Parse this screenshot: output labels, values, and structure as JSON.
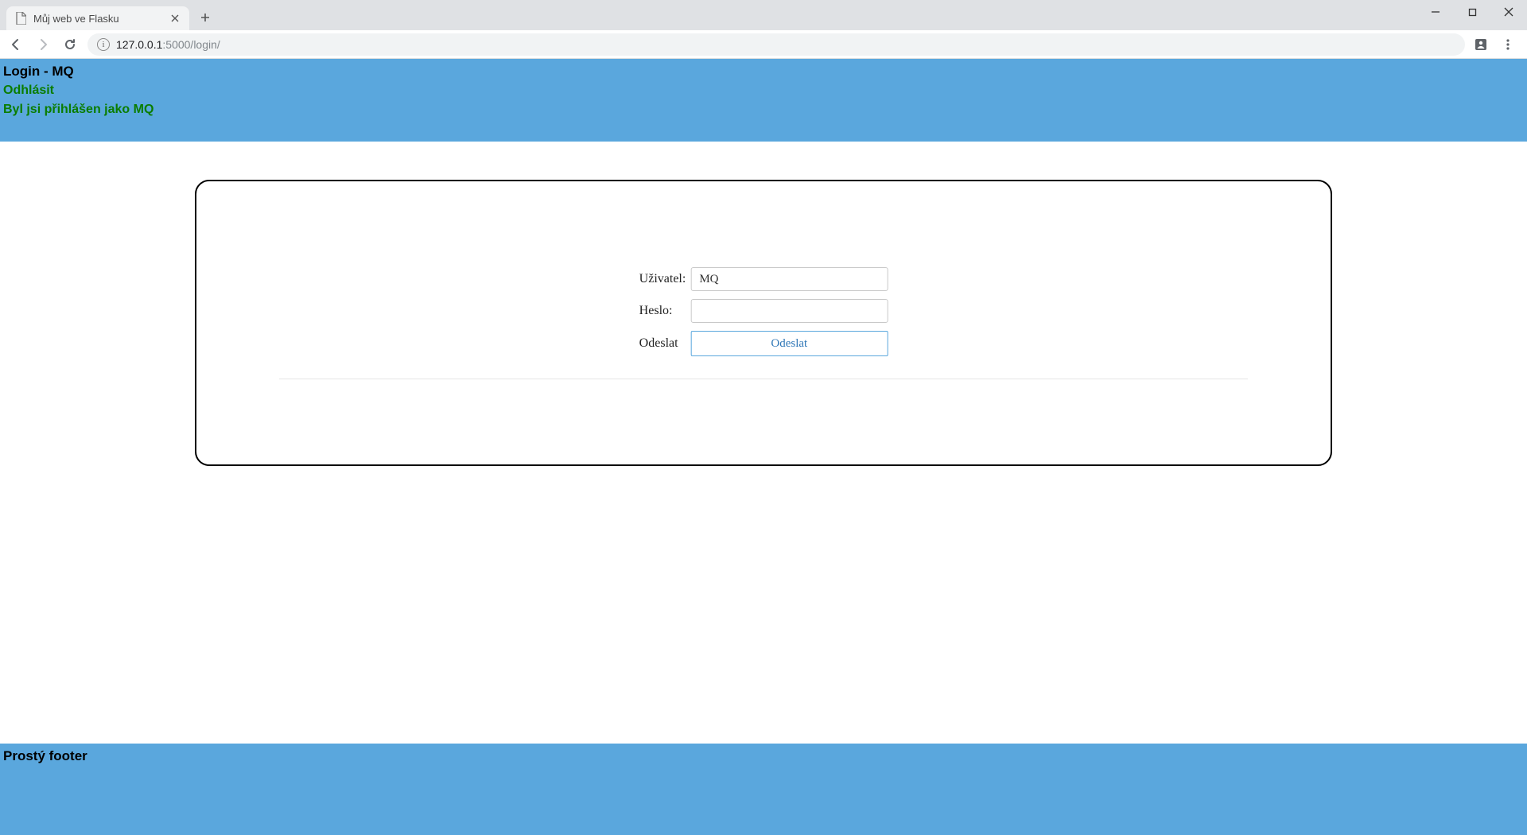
{
  "browser": {
    "tab_title": "Můj web ve Flasku",
    "url_host": "127.0.0.1",
    "url_port_path": ":5000/login/"
  },
  "header": {
    "title": "Login - MQ",
    "logout_link": "Odhlásit",
    "logged_in_msg": "Byl jsi přihlášen jako MQ"
  },
  "form": {
    "user_label": "Uživatel:",
    "user_value": "MQ",
    "password_label": "Heslo:",
    "password_value": "",
    "submit_label_left": "Odeslat",
    "submit_button": "Odeslat"
  },
  "footer": {
    "text": "Prostý footer"
  }
}
